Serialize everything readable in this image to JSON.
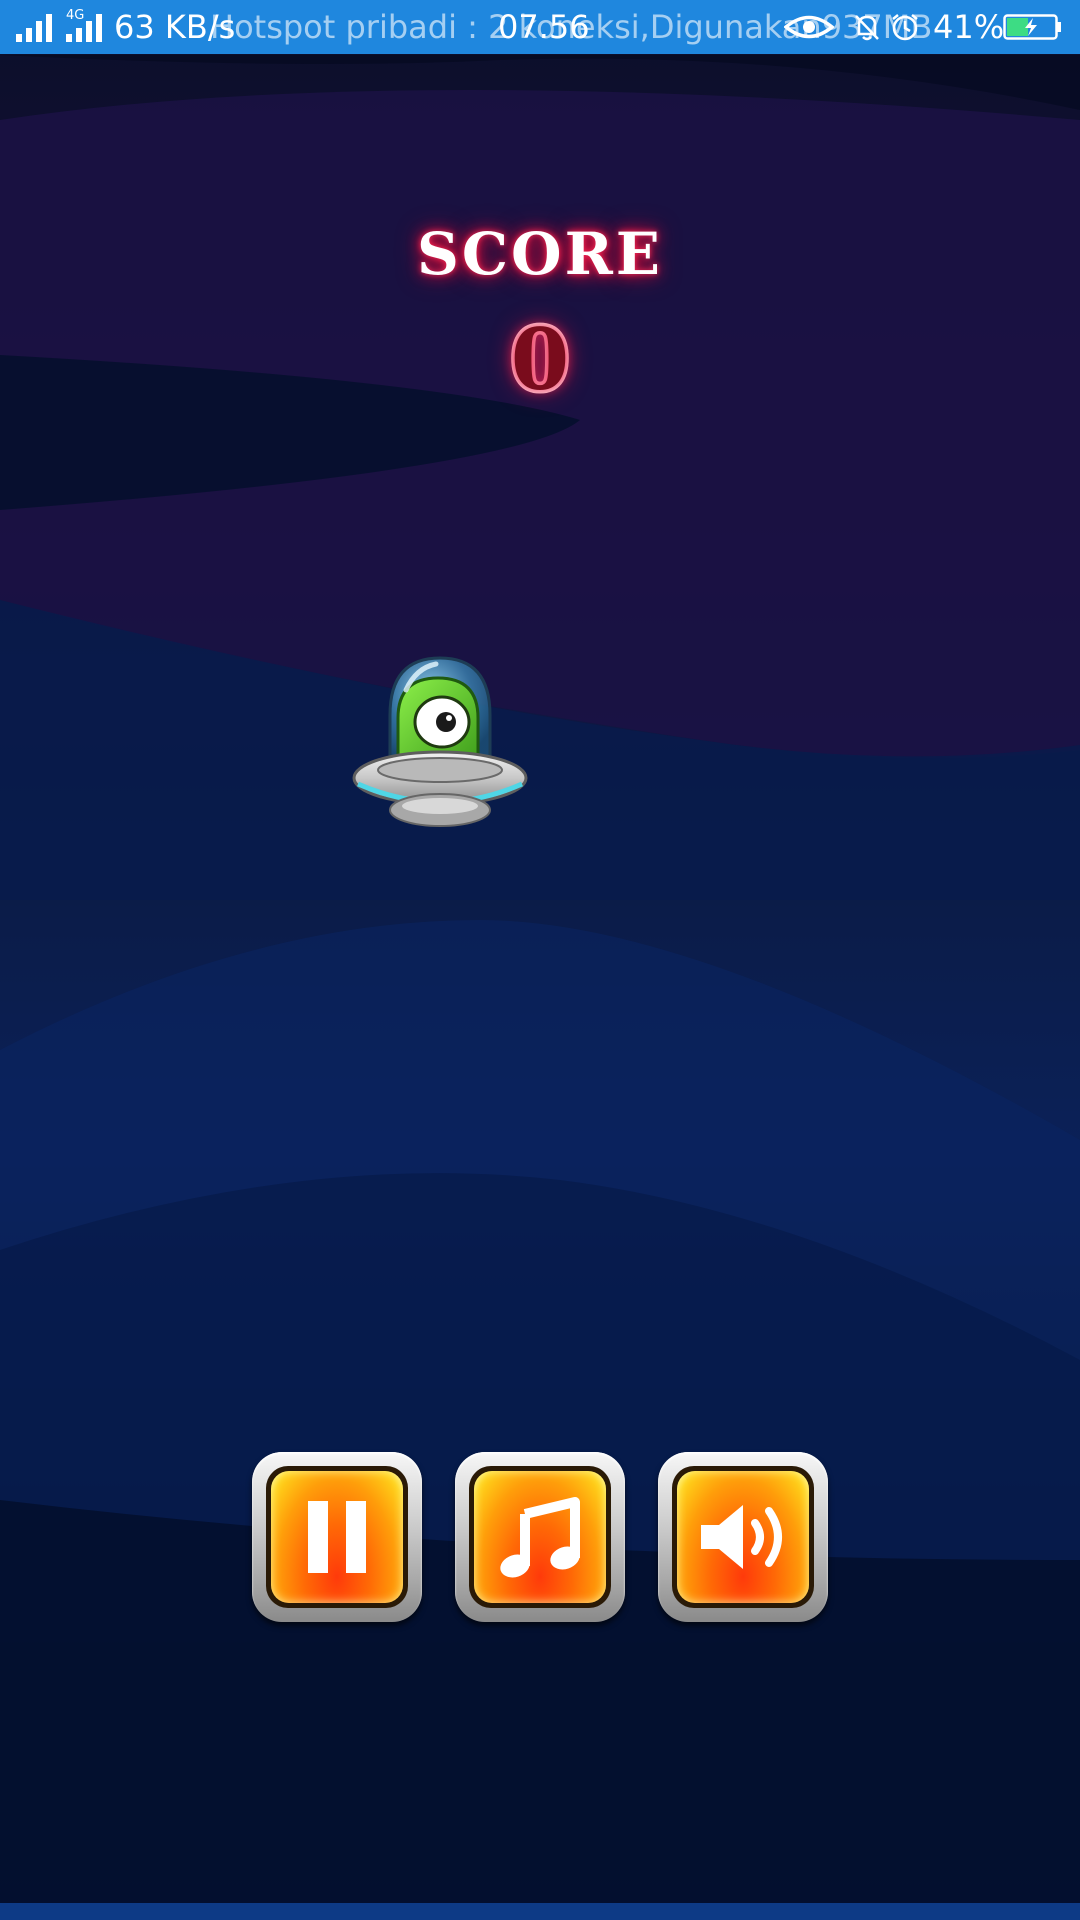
{
  "status_bar": {
    "network_label": "4G",
    "speed": "63 KB/s",
    "notification": "Hotspot pribadi : 2 koneksi,Digunakan937MB",
    "time": "07.56",
    "battery": "41%",
    "icons": [
      "signal-icon",
      "signal-4g-icon",
      "eye-icon",
      "bell-off-icon",
      "alarm-icon",
      "battery-charging-icon"
    ],
    "background_color": "#1f87de"
  },
  "game": {
    "score_label": "SCORE",
    "score": "0",
    "player": "ufo-alien",
    "controls": [
      {
        "id": "pause",
        "icon": "pause-icon"
      },
      {
        "id": "music",
        "icon": "music-note-icon"
      },
      {
        "id": "sound",
        "icon": "speaker-icon"
      }
    ],
    "button_colors": {
      "glow_top": "#ffd21a",
      "glow_bottom": "#ff3a0a",
      "frame": "#b0b0b0"
    }
  }
}
